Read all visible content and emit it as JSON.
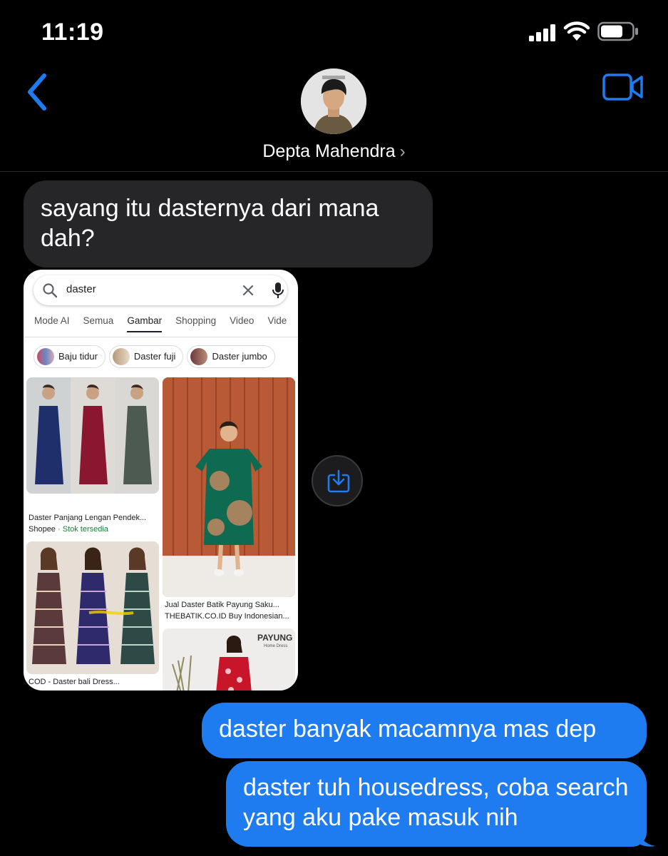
{
  "status_bar": {
    "time": "11:19"
  },
  "header": {
    "contact_name": "Depta Mahendra",
    "chevron": "›"
  },
  "messages": {
    "incoming_1": "sayang itu dasternya dari mana dah?",
    "outgoing_1": "daster banyak macamnya mas dep",
    "outgoing_2": "daster tuh housedress, coba search yang aku pake masuk nih"
  },
  "screenshot": {
    "search_query": "daster",
    "tabs": [
      "Mode AI",
      "Semua",
      "Gambar",
      "Shopping",
      "Video",
      "Vide"
    ],
    "active_tab": "Gambar",
    "chips": [
      "Baju tidur",
      "Daster fuji",
      "Daster jumbo"
    ],
    "results": [
      {
        "title": "Daster Panjang Lengan Pendek...",
        "source": "Shopee",
        "stock": " · Stok tersedia"
      },
      {
        "title": "Jual Daster Batik Payung Saku...",
        "source": "THEBATIK.CO.ID Buy Indonesian..."
      },
      {
        "title": "COD - Daster bali Dress..."
      }
    ],
    "brand_text": "PAYUNG",
    "brand_sub": "Home Dress"
  },
  "colors": {
    "outgoing_bubble": "#1f7cf0",
    "incoming_bubble": "#262628",
    "accent": "#1f7cf0"
  },
  "icons": {
    "back": "chevron-left-icon",
    "video": "video-camera-icon",
    "save": "save-to-files-icon"
  }
}
